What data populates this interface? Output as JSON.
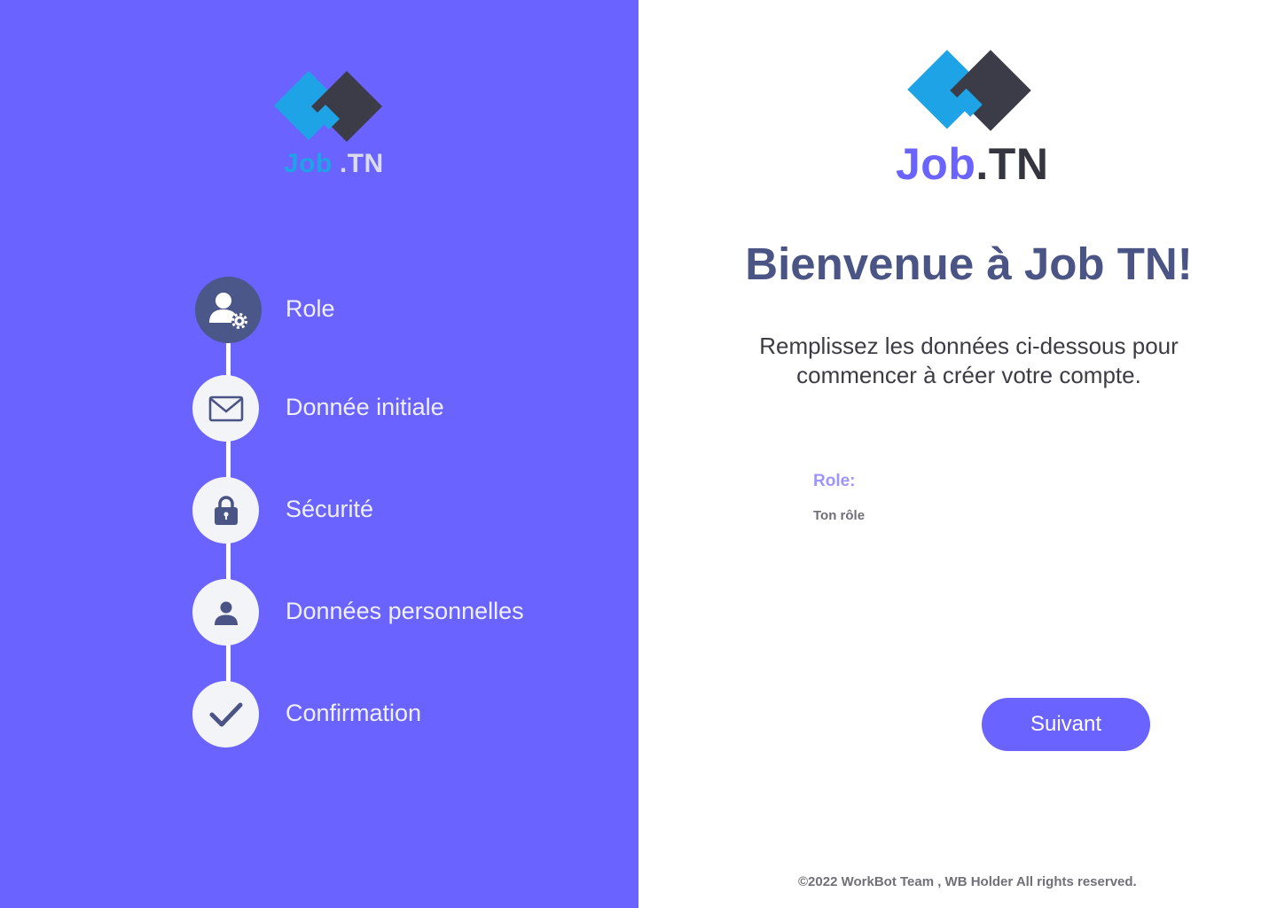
{
  "brand": {
    "name_part1": "Job",
    "name_part2": ".TN",
    "colors": {
      "accent": "#6a63ff",
      "logo_blue": "#1da3e6",
      "logo_dark": "#3c3c48",
      "heading": "#4a5485"
    }
  },
  "steps": [
    {
      "label": "Role",
      "icon": "user-gear-icon",
      "active": true
    },
    {
      "label": "Donnée initiale",
      "icon": "envelope-icon",
      "active": false
    },
    {
      "label": "Sécurité",
      "icon": "lock-icon",
      "active": false
    },
    {
      "label": "Données personnelles",
      "icon": "person-icon",
      "active": false
    },
    {
      "label": "Confirmation",
      "icon": "checkmark-icon",
      "active": false
    }
  ],
  "main": {
    "title": "Bienvenue à Job TN!",
    "subtitle": "Remplissez les données ci-dessous pour commencer à créer votre compte.",
    "role_label": "Role:",
    "role_value": "Ton rôle",
    "next_button": "Suivant"
  },
  "footer": "©2022 WorkBot Team , WB Holder All rights reserved."
}
